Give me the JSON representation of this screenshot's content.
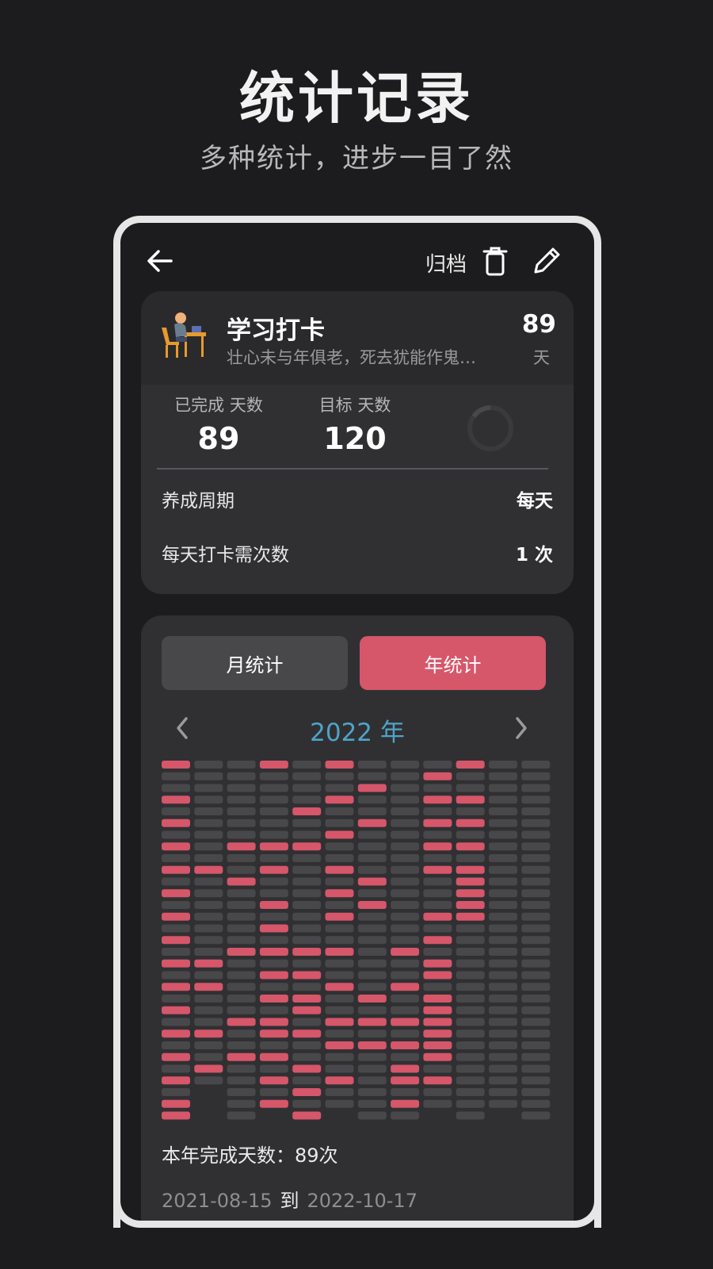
{
  "hero": {
    "title": "统计记录",
    "subtitle": "多种统计，进步一目了然"
  },
  "topbar": {
    "archive_label": "归档"
  },
  "habit": {
    "name": "学习打卡",
    "motto": "壮心未与年俱老，死去犹能作鬼…",
    "streak_value": "89",
    "streak_unit": "天"
  },
  "stats": {
    "completed_label": "已完成 天数",
    "completed_value": "89",
    "target_label": "目标 天数",
    "target_value": "120"
  },
  "details": {
    "cycle_label": "养成周期",
    "cycle_value": "每天",
    "times_label": "每天打卡需次数",
    "times_value": "1 次"
  },
  "tabs": {
    "month": "月统计",
    "year": "年统计",
    "selected": "年统计"
  },
  "year_nav": {
    "year_label": "2022 年"
  },
  "heatmap": {
    "months": 12,
    "days_in_month": [
      31,
      28,
      31,
      30,
      31,
      30,
      31,
      31,
      30,
      31,
      30,
      31
    ],
    "colors": {
      "done": "#d6566a",
      "empty": "#48484b"
    },
    "done_days": [
      [
        1,
        4,
        6,
        8,
        10,
        12,
        14,
        16,
        18,
        20,
        22,
        24,
        26,
        28,
        30,
        31
      ],
      [
        10,
        18,
        20,
        24,
        27
      ],
      [
        8,
        11,
        17,
        23,
        26
      ],
      [
        1,
        8,
        10,
        13,
        15,
        17,
        19,
        21,
        23,
        24,
        26,
        28,
        30
      ],
      [
        5,
        8,
        17,
        19,
        21,
        22,
        24,
        27,
        29,
        31
      ],
      [
        1,
        4,
        7,
        10,
        12,
        14,
        17,
        20,
        23,
        25,
        28
      ],
      [
        3,
        6,
        11,
        13,
        21,
        23,
        25
      ],
      [
        17,
        20,
        23,
        25,
        27,
        28,
        30
      ],
      [
        2,
        4,
        6,
        8,
        10,
        14,
        16,
        18,
        19,
        21,
        22,
        23,
        24,
        25,
        26,
        28
      ],
      [
        1,
        4,
        6,
        8,
        10,
        11,
        12,
        13,
        14
      ]
    ]
  },
  "summary": {
    "text": "本年完成天数：89次"
  },
  "range": {
    "start": "2021-08-15",
    "to": "到",
    "end": "2022-10-17"
  },
  "colors": {
    "accent": "#d6566a",
    "year_text": "#4fa3c8",
    "card": "#303033",
    "background": "#1c1c1e"
  }
}
